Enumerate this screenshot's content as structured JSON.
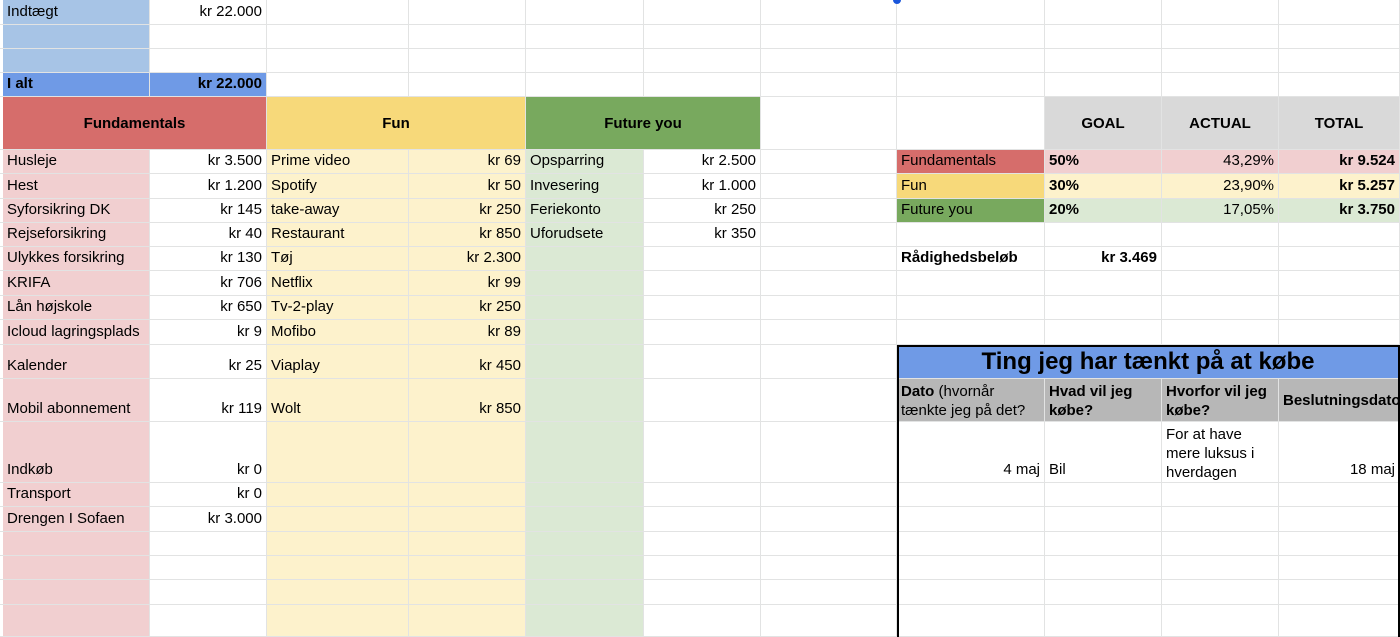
{
  "income": {
    "label": "Indtægt",
    "value": "kr 22.000",
    "total_label": "I alt",
    "total_value": "kr 22.000"
  },
  "categories": {
    "fundamentals": {
      "header": "Fundamentals",
      "items": [
        {
          "name": "Husleje",
          "amount": "kr 3.500"
        },
        {
          "name": "Hest",
          "amount": "kr 1.200"
        },
        {
          "name": "Syforsikring DK",
          "amount": "kr 145"
        },
        {
          "name": "Rejseforsikring",
          "amount": "kr 40"
        },
        {
          "name": "Ulykkes forsikring",
          "amount": "kr 130"
        },
        {
          "name": "KRIFA",
          "amount": "kr 706"
        },
        {
          "name": "Lån højskole",
          "amount": "kr 650"
        },
        {
          "name": "Icloud lagringsplads",
          "amount": "kr 9"
        },
        {
          "name": "Kalender",
          "amount": "kr 25"
        },
        {
          "name": "Mobil abonnement",
          "amount": "kr 119"
        },
        {
          "name": "Indkøb",
          "amount": "kr 0"
        },
        {
          "name": "Transport",
          "amount": "kr 0"
        },
        {
          "name": "Drengen I Sofaen",
          "amount": "kr 3.000"
        }
      ]
    },
    "fun": {
      "header": "Fun",
      "items": [
        {
          "name": "Prime video",
          "amount": "kr 69"
        },
        {
          "name": "Spotify",
          "amount": "kr 50"
        },
        {
          "name": "take-away",
          "amount": "kr 250"
        },
        {
          "name": "Restaurant",
          "amount": "kr 850"
        },
        {
          "name": "Tøj",
          "amount": "kr 2.300"
        },
        {
          "name": "Netflix",
          "amount": "kr 99"
        },
        {
          "name": "Tv-2-play",
          "amount": "kr 250"
        },
        {
          "name": "Mofibo",
          "amount": "kr 89"
        },
        {
          "name": "Viaplay",
          "amount": "kr 450"
        },
        {
          "name": "Wolt",
          "amount": "kr 850"
        }
      ]
    },
    "future": {
      "header": "Future you",
      "items": [
        {
          "name": "Opsparring",
          "amount": "kr 2.500"
        },
        {
          "name": "Invesering",
          "amount": "kr 1.000"
        },
        {
          "name": "Feriekonto",
          "amount": "kr 250"
        },
        {
          "name": "Uforudsete",
          "amount": "kr 350"
        }
      ]
    }
  },
  "summary": {
    "headers": [
      "GOAL",
      "ACTUAL",
      "TOTAL"
    ],
    "rows": [
      {
        "label": "Fundamentals",
        "goal": "50%",
        "actual": "43,29%",
        "total": "kr 9.524"
      },
      {
        "label": "Fun",
        "goal": "30%",
        "actual": "23,90%",
        "total": "kr 5.257"
      },
      {
        "label": "Future you",
        "goal": "20%",
        "actual": "17,05%",
        "total": "kr 3.750"
      }
    ],
    "available_label": "Rådighedsbeløb",
    "available_value": "kr 3.469"
  },
  "wishlist": {
    "title": "Ting jeg har tænkt på at købe",
    "col1_bold": "Dato",
    "col1_rest": " (hvornår tænkte jeg på det?",
    "col2": "Hvad vil jeg købe?",
    "col3": "Hvorfor vil jeg købe?",
    "col4": "Beslutningsdato",
    "rows": [
      {
        "date": "4 maj",
        "what": "Bil",
        "why": "For at have mere luksus i hverdagen",
        "decision": "18 maj"
      }
    ]
  },
  "colors": {
    "fundamentals": "#d66d6b",
    "fun": "#f7d97a",
    "future": "#78a95e",
    "income": "#a7c4e6",
    "total": "#6f9ae6"
  }
}
